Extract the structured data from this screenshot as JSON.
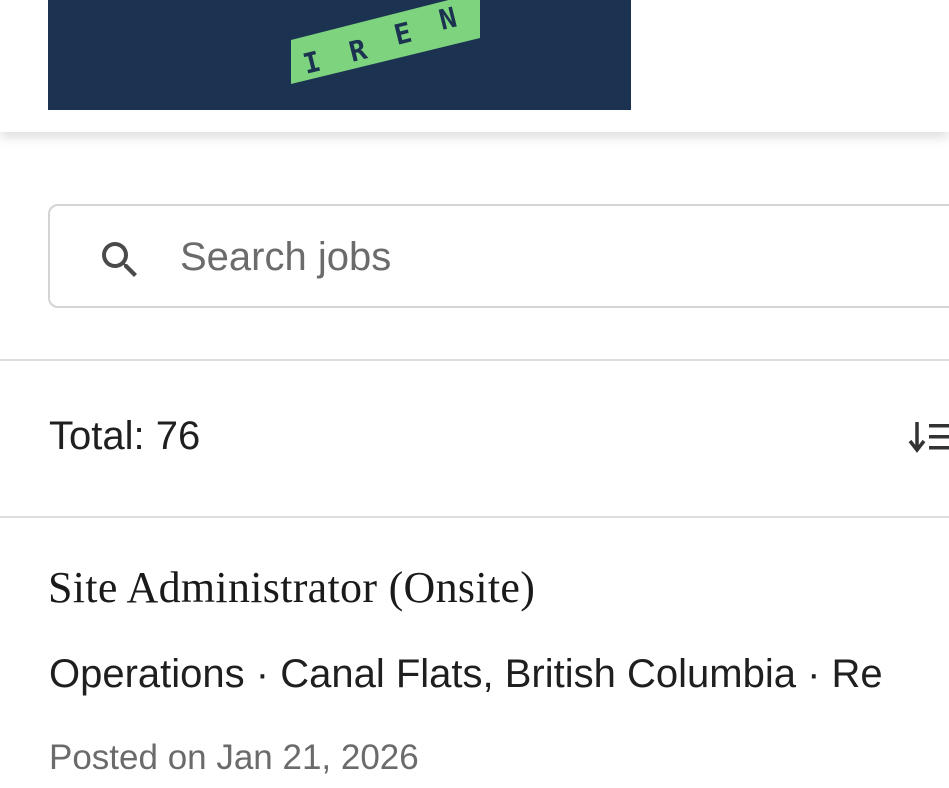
{
  "header": {
    "logo_text": "IREN",
    "banner_color": "#1b3350",
    "logo_color": "#7ed37f"
  },
  "search": {
    "placeholder": "Search jobs",
    "icon": "search-icon"
  },
  "results": {
    "total_label": "Total: 76",
    "sort_icon": "sort-icon"
  },
  "jobs": [
    {
      "title": "Site Administrator (Onsite)",
      "meta": "Operations · Canal Flats, British Columbia · Re",
      "posted": "Posted on Jan 21, 2026"
    }
  ]
}
